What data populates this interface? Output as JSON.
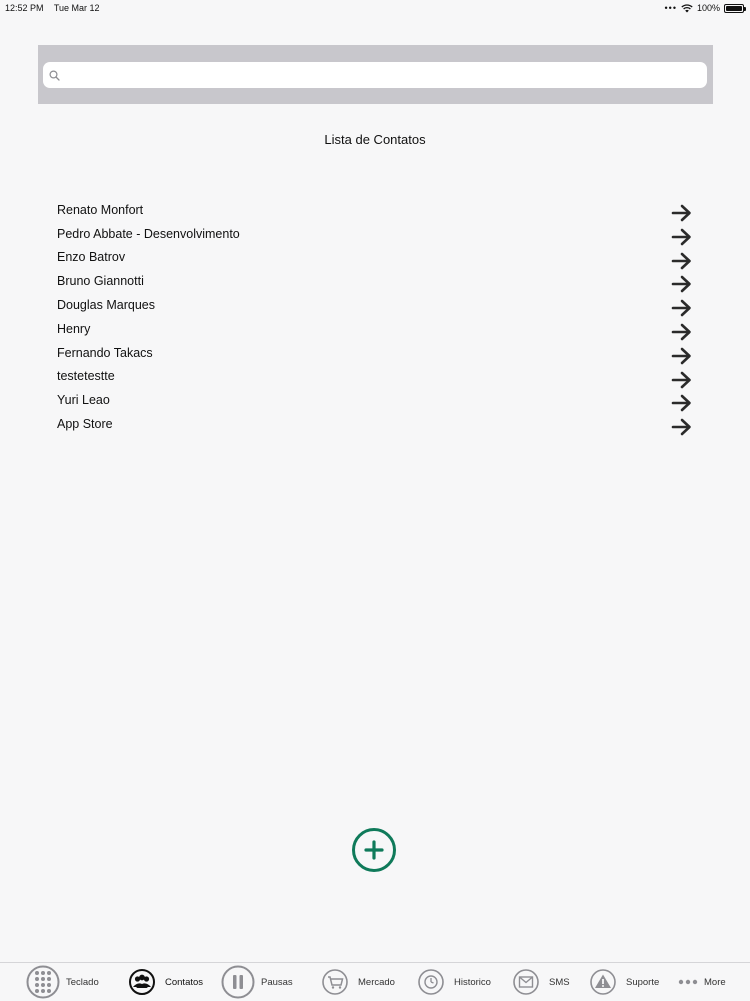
{
  "status_bar": {
    "time": "12:52 PM",
    "date": "Tue Mar 12",
    "battery": "100%",
    "battery_level": 1.0
  },
  "search": {
    "placeholder": "",
    "value": ""
  },
  "page_title": "Lista de Contatos",
  "contacts": [
    {
      "name": "Renato Monfort"
    },
    {
      "name": "Pedro Abbate - Desenvolvimento"
    },
    {
      "name": "Enzo Batrov"
    },
    {
      "name": "Bruno Giannotti"
    },
    {
      "name": "Douglas Marques"
    },
    {
      "name": "Henry"
    },
    {
      "name": "Fernando Takacs"
    },
    {
      "name": "testetestte"
    },
    {
      "name": "Yuri Leao"
    },
    {
      "name": "App Store"
    }
  ],
  "colors": {
    "accent": "#0f7a5a",
    "tab_icon": "#8e8e93",
    "active_icon": "#111111",
    "arrow": "#2b2b2b"
  },
  "tabs": [
    {
      "label": "Teclado",
      "icon": "keypad-icon",
      "active": false
    },
    {
      "label": "Contatos",
      "icon": "contacts-icon",
      "active": true
    },
    {
      "label": "Pausas",
      "icon": "pause-icon",
      "active": false
    },
    {
      "label": "Mercado",
      "icon": "cart-icon",
      "active": false
    },
    {
      "label": "Historico",
      "icon": "history-icon",
      "active": false
    },
    {
      "label": "SMS",
      "icon": "mail-icon",
      "active": false
    },
    {
      "label": "Suporte",
      "icon": "warning-icon",
      "active": false
    },
    {
      "label": "More",
      "icon": "more-icon",
      "active": false
    }
  ]
}
